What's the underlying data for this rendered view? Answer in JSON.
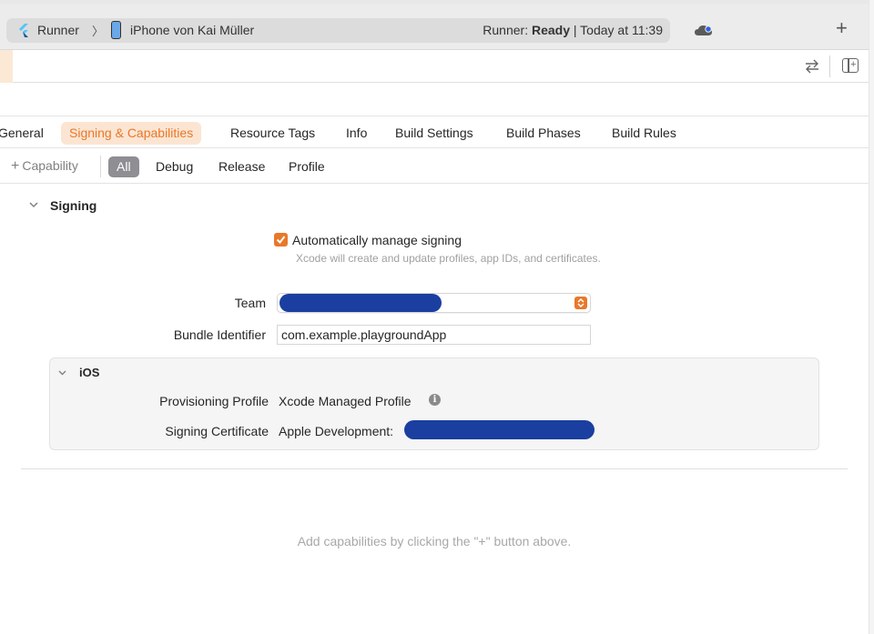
{
  "toolbar": {
    "scheme": "Runner",
    "device": "iPhone von Kai Müller",
    "status_prefix": "Runner: ",
    "status_state": "Ready",
    "status_suffix": " | Today at 11:39",
    "add_symbol": "+"
  },
  "tabs": [
    {
      "label": "General"
    },
    {
      "label": "Signing & Capabilities",
      "active": true
    },
    {
      "label": "Resource Tags"
    },
    {
      "label": "Info"
    },
    {
      "label": "Build Settings"
    },
    {
      "label": "Build Phases"
    },
    {
      "label": "Build Rules"
    }
  ],
  "filters": {
    "capability_label": "Capability",
    "items": [
      "All",
      "Debug",
      "Release",
      "Profile"
    ],
    "selected": "All"
  },
  "signing": {
    "section_title": "Signing",
    "auto_manage_label": "Automatically manage signing",
    "auto_manage_checked": true,
    "auto_manage_desc": "Xcode will create and update profiles, app IDs, and certificates.",
    "team_label": "Team",
    "bundle_label": "Bundle Identifier",
    "bundle_value": "com.example.playgroundApp"
  },
  "ios": {
    "title": "iOS",
    "provisioning_label": "Provisioning Profile",
    "provisioning_value": "Xcode Managed Profile",
    "certificate_label": "Signing Certificate",
    "certificate_value": "Apple Development:"
  },
  "hint": "Add capabilities by clicking the \"+\" button above.",
  "colors": {
    "accent": "#e8782a",
    "accent_bg": "#fbe5d2",
    "redaction": "#1a3fa0"
  }
}
